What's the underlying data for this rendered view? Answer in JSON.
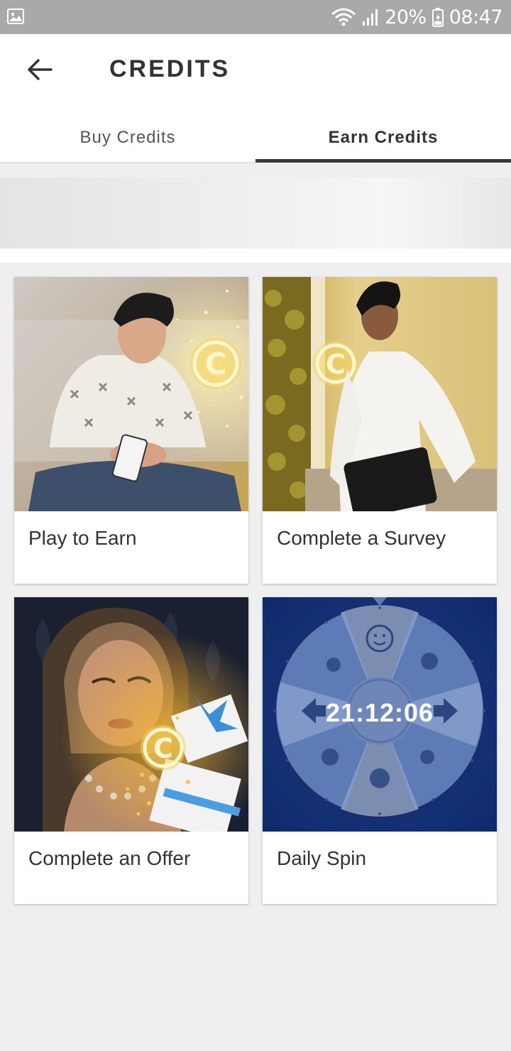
{
  "status_bar": {
    "battery": "20%",
    "time": "08:47",
    "icons": [
      "gallery-icon",
      "wifi-icon",
      "signal-icon",
      "battery-icon"
    ]
  },
  "header": {
    "title": "CREDITS",
    "back_icon": "arrow-left-icon"
  },
  "tabs": [
    {
      "label": "Buy Credits",
      "active": false
    },
    {
      "label": "Earn Credits",
      "active": true
    }
  ],
  "cards": [
    {
      "label": "Play to Earn",
      "image": "man-with-phone-and-credit-coin"
    },
    {
      "label": "Complete a Survey",
      "image": "woman-with-tablet-and-credit-coin"
    },
    {
      "label": "Complete an Offer",
      "image": "woman-with-gift-box-and-credit-coin"
    },
    {
      "label": "Daily Spin",
      "image": "prize-wheel",
      "timer": "21:12:06"
    }
  ],
  "colors": {
    "status_bar": "#a9a9a9",
    "active_tab_underline": "#3a3a3a",
    "credit_coin": "#f5d35a",
    "spin_background": "#0f2a6b"
  }
}
